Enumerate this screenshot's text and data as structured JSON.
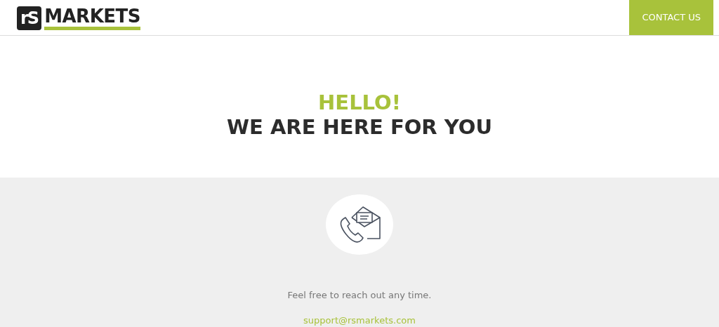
{
  "header": {
    "logo": {
      "mark": "rS",
      "word": "MARKETS"
    },
    "contact_button": "CONTACT US"
  },
  "hero": {
    "greeting": "HELLO!",
    "headline": "WE ARE HERE FOR YOU"
  },
  "contact": {
    "message": "Feel free to reach out any time.",
    "email": "support@rsmarkets.com"
  }
}
